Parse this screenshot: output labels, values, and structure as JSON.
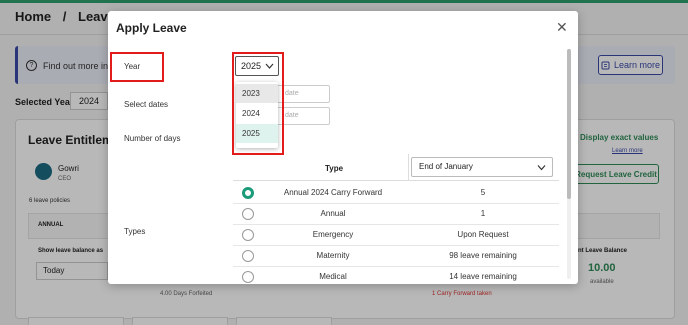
{
  "background": {
    "breadcrumb": [
      "Home",
      "/",
      "Leave"
    ],
    "info_banner": "Find out more info",
    "learn_more": "Learn more",
    "selected_year_label": "Selected Year",
    "selected_year_value": "2024",
    "card_title": "Leave Entitleme",
    "employee": {
      "name": "Gowri",
      "role": "CEO"
    },
    "policies_count": "6 leave policies",
    "annual_tab": "ANNUAL",
    "show_balance": "Show leave balance as",
    "today": "Today",
    "display_exact": "Display exact values",
    "learn_more_link": "Learn more",
    "request_credit": "Request Leave Credit",
    "current_balance_label": "nt Leave Balance",
    "current_balance_value": "10.00",
    "available": "available",
    "forfeited": "4.00 Days Forfeited",
    "carry_taken": "1 Carry Forward taken"
  },
  "modal": {
    "title": "Apply Leave",
    "close_icon": "close-icon",
    "labels": {
      "year": "Year",
      "select_dates": "Select dates",
      "number_of_days": "Number of days",
      "types": "Types"
    },
    "year_select": {
      "value": "2025",
      "options": [
        "2023",
        "2024",
        "2025"
      ]
    },
    "date_start_placeholder": "date",
    "date_end_placeholder": "date",
    "type_table": {
      "header_type": "Type",
      "month_select": "End of January",
      "rows": [
        {
          "name": "Annual 2024 Carry Forward",
          "value": "5",
          "selected": true
        },
        {
          "name": "Annual",
          "value": "1",
          "selected": false
        },
        {
          "name": "Emergency",
          "value": "Upon Request",
          "selected": false
        },
        {
          "name": "Maternity",
          "value": "98 leave remaining",
          "selected": false
        },
        {
          "name": "Medical",
          "value": "14 leave remaining",
          "selected": false
        }
      ]
    }
  },
  "colors": {
    "accent_green": "#1a9c7a",
    "highlight_red": "#e21b1b",
    "brand_blue": "#3b4aa8"
  }
}
